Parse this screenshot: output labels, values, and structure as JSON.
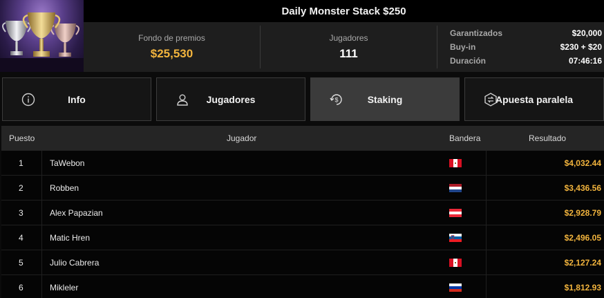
{
  "tournament": {
    "title": "Daily Monster Stack $250",
    "prize_pool_label": "Fondo de premios",
    "prize_pool_value": "$25,530",
    "players_label": "Jugadores",
    "players_value": "111",
    "details": [
      {
        "label": "Garantizados",
        "value": "$20,000"
      },
      {
        "label": "Buy-in",
        "value": "$230 + $20"
      },
      {
        "label": "Duración",
        "value": "07:46:16"
      }
    ]
  },
  "tabs": [
    {
      "label": "Info",
      "icon": "info-icon",
      "active": false
    },
    {
      "label": "Jugadores",
      "icon": "user-icon",
      "active": false
    },
    {
      "label": "Staking",
      "icon": "dollar-cycle-icon",
      "active": true
    },
    {
      "label": "Apuesta paralela",
      "icon": "side-bet-icon",
      "active": false
    }
  ],
  "table": {
    "columns": {
      "position": "Puesto",
      "player": "Jugador",
      "flag": "Bandera",
      "result": "Resultado"
    },
    "rows": [
      {
        "position": "1",
        "player": "TaWebon",
        "flag": "peru-flag-icon",
        "result": "$4,032.44"
      },
      {
        "position": "2",
        "player": "Robben",
        "flag": "netherlands-flag-icon",
        "result": "$3,436.56"
      },
      {
        "position": "3",
        "player": "Alex Papazian",
        "flag": "austria-flag-icon",
        "result": "$2,928.79"
      },
      {
        "position": "4",
        "player": "Matic Hren",
        "flag": "slovenia-flag-icon",
        "result": "$2,496.05"
      },
      {
        "position": "5",
        "player": "Julio Cabrera",
        "flag": "peru-flag-icon",
        "result": "$2,127.24"
      },
      {
        "position": "6",
        "player": "Mikleler",
        "flag": "russia-flag-icon",
        "result": "$1,812.93"
      }
    ]
  },
  "colors": {
    "accent_gold": "#f2b43d",
    "active_tab": "#3b3b3b",
    "background": "#0b0b0b"
  }
}
